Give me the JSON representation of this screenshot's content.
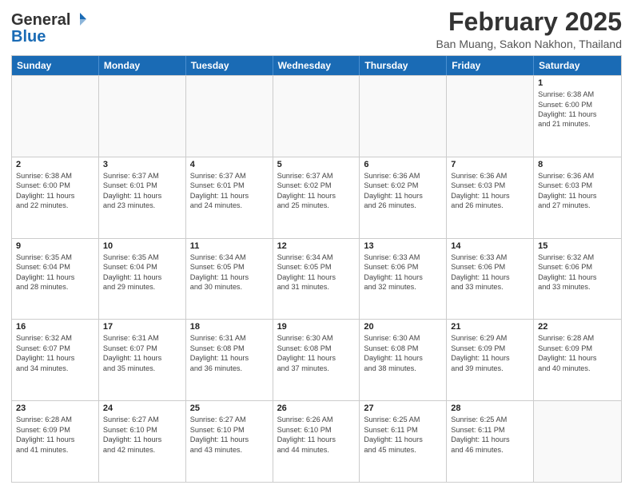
{
  "header": {
    "logo_general": "General",
    "logo_blue": "Blue",
    "month_title": "February 2025",
    "location": "Ban Muang, Sakon Nakhon, Thailand"
  },
  "days_of_week": [
    "Sunday",
    "Monday",
    "Tuesday",
    "Wednesday",
    "Thursday",
    "Friday",
    "Saturday"
  ],
  "weeks": [
    [
      {
        "day": "",
        "info": ""
      },
      {
        "day": "",
        "info": ""
      },
      {
        "day": "",
        "info": ""
      },
      {
        "day": "",
        "info": ""
      },
      {
        "day": "",
        "info": ""
      },
      {
        "day": "",
        "info": ""
      },
      {
        "day": "1",
        "info": "Sunrise: 6:38 AM\nSunset: 6:00 PM\nDaylight: 11 hours\nand 21 minutes."
      }
    ],
    [
      {
        "day": "2",
        "info": "Sunrise: 6:38 AM\nSunset: 6:00 PM\nDaylight: 11 hours\nand 22 minutes."
      },
      {
        "day": "3",
        "info": "Sunrise: 6:37 AM\nSunset: 6:01 PM\nDaylight: 11 hours\nand 23 minutes."
      },
      {
        "day": "4",
        "info": "Sunrise: 6:37 AM\nSunset: 6:01 PM\nDaylight: 11 hours\nand 24 minutes."
      },
      {
        "day": "5",
        "info": "Sunrise: 6:37 AM\nSunset: 6:02 PM\nDaylight: 11 hours\nand 25 minutes."
      },
      {
        "day": "6",
        "info": "Sunrise: 6:36 AM\nSunset: 6:02 PM\nDaylight: 11 hours\nand 26 minutes."
      },
      {
        "day": "7",
        "info": "Sunrise: 6:36 AM\nSunset: 6:03 PM\nDaylight: 11 hours\nand 26 minutes."
      },
      {
        "day": "8",
        "info": "Sunrise: 6:36 AM\nSunset: 6:03 PM\nDaylight: 11 hours\nand 27 minutes."
      }
    ],
    [
      {
        "day": "9",
        "info": "Sunrise: 6:35 AM\nSunset: 6:04 PM\nDaylight: 11 hours\nand 28 minutes."
      },
      {
        "day": "10",
        "info": "Sunrise: 6:35 AM\nSunset: 6:04 PM\nDaylight: 11 hours\nand 29 minutes."
      },
      {
        "day": "11",
        "info": "Sunrise: 6:34 AM\nSunset: 6:05 PM\nDaylight: 11 hours\nand 30 minutes."
      },
      {
        "day": "12",
        "info": "Sunrise: 6:34 AM\nSunset: 6:05 PM\nDaylight: 11 hours\nand 31 minutes."
      },
      {
        "day": "13",
        "info": "Sunrise: 6:33 AM\nSunset: 6:06 PM\nDaylight: 11 hours\nand 32 minutes."
      },
      {
        "day": "14",
        "info": "Sunrise: 6:33 AM\nSunset: 6:06 PM\nDaylight: 11 hours\nand 33 minutes."
      },
      {
        "day": "15",
        "info": "Sunrise: 6:32 AM\nSunset: 6:06 PM\nDaylight: 11 hours\nand 33 minutes."
      }
    ],
    [
      {
        "day": "16",
        "info": "Sunrise: 6:32 AM\nSunset: 6:07 PM\nDaylight: 11 hours\nand 34 minutes."
      },
      {
        "day": "17",
        "info": "Sunrise: 6:31 AM\nSunset: 6:07 PM\nDaylight: 11 hours\nand 35 minutes."
      },
      {
        "day": "18",
        "info": "Sunrise: 6:31 AM\nSunset: 6:08 PM\nDaylight: 11 hours\nand 36 minutes."
      },
      {
        "day": "19",
        "info": "Sunrise: 6:30 AM\nSunset: 6:08 PM\nDaylight: 11 hours\nand 37 minutes."
      },
      {
        "day": "20",
        "info": "Sunrise: 6:30 AM\nSunset: 6:08 PM\nDaylight: 11 hours\nand 38 minutes."
      },
      {
        "day": "21",
        "info": "Sunrise: 6:29 AM\nSunset: 6:09 PM\nDaylight: 11 hours\nand 39 minutes."
      },
      {
        "day": "22",
        "info": "Sunrise: 6:28 AM\nSunset: 6:09 PM\nDaylight: 11 hours\nand 40 minutes."
      }
    ],
    [
      {
        "day": "23",
        "info": "Sunrise: 6:28 AM\nSunset: 6:09 PM\nDaylight: 11 hours\nand 41 minutes."
      },
      {
        "day": "24",
        "info": "Sunrise: 6:27 AM\nSunset: 6:10 PM\nDaylight: 11 hours\nand 42 minutes."
      },
      {
        "day": "25",
        "info": "Sunrise: 6:27 AM\nSunset: 6:10 PM\nDaylight: 11 hours\nand 43 minutes."
      },
      {
        "day": "26",
        "info": "Sunrise: 6:26 AM\nSunset: 6:10 PM\nDaylight: 11 hours\nand 44 minutes."
      },
      {
        "day": "27",
        "info": "Sunrise: 6:25 AM\nSunset: 6:11 PM\nDaylight: 11 hours\nand 45 minutes."
      },
      {
        "day": "28",
        "info": "Sunrise: 6:25 AM\nSunset: 6:11 PM\nDaylight: 11 hours\nand 46 minutes."
      },
      {
        "day": "",
        "info": ""
      }
    ]
  ]
}
